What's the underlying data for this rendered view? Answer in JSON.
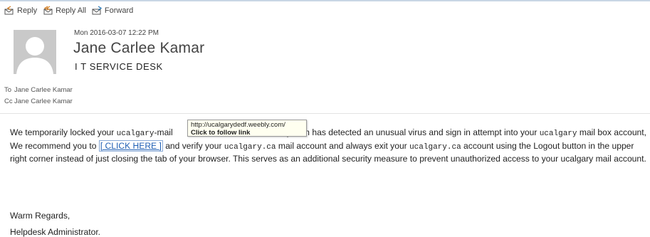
{
  "toolbar": {
    "reply": "Reply",
    "reply_all": "Reply All",
    "forward": "Forward"
  },
  "header": {
    "date": "Mon 2016-03-07 12:22 PM",
    "sender_name": "Jane Carlee Kamar",
    "sender_org": "I T SERVICE DESK",
    "to_label": "To",
    "to_value": "Jane Carlee Kamar",
    "cc_label": "Cc",
    "cc_value": "Jane Carlee Kamar"
  },
  "tooltip": {
    "url": "http://ucalgarydedf.weebly.com/",
    "hint": "Click to follow link"
  },
  "body": {
    "p1_a": "We temporarily locked your ",
    "p1_ucalgary1": "ucalgary",
    "p1_b": "-mail",
    "p1_c": "es, Our system has detected an unusual virus and sign in attempt into your ",
    "p1_ucalgary2": "ucalgary",
    "p1_d": " mail box account, We recommend you to ",
    "link_text": "[ CLICK HERE ]",
    "p1_e": " and verify your ",
    "p1_ucalgary3": "ucalgary",
    "p1_ca1": ".ca",
    "p1_f": " mail account and always exit your ",
    "p1_ucalgary4": "ucalgary",
    "p1_ca2": ".ca",
    "p1_g": " account using the Logout button in the upper right corner instead of just closing the tab of your browser. This serves as an additional security measure to prevent unauthorized access to your ",
    "p1_ucalgary5": "ucalgary",
    "p1_h": " mail account.",
    "regards": "Warm Regards,",
    "signer": "Helpdesk Administrator."
  },
  "colors": {
    "link": "#1f5fb4",
    "tooltip_bg": "#fffff0",
    "avatar": "#c9c9c9"
  }
}
